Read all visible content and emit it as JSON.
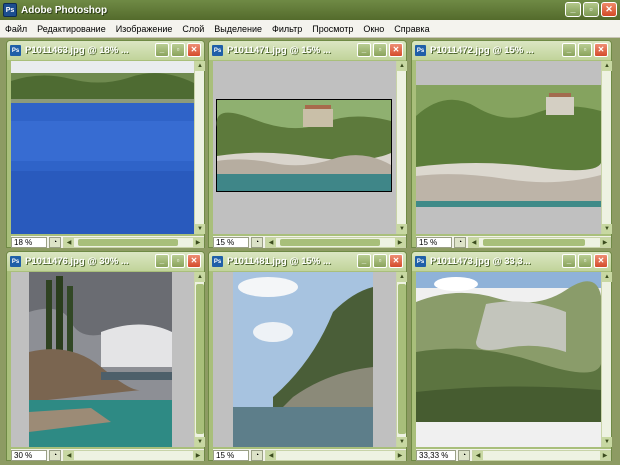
{
  "app": {
    "title": "Adobe Photoshop",
    "logo_text": "Ps"
  },
  "window_buttons": {
    "minimize": "_",
    "maximize": "▫",
    "close": "✕"
  },
  "menu": [
    "Файл",
    "Редактирование",
    "Изображение",
    "Слой",
    "Выделение",
    "Фильтр",
    "Просмотр",
    "Окно",
    "Справка"
  ],
  "documents": [
    {
      "title": "P1011463.jpg @ 18% ...",
      "zoom": "18 %"
    },
    {
      "title": "P1011471.jpg @ 15% ...",
      "zoom": "15 %"
    },
    {
      "title": "P1011472.jpg @ 15% ...",
      "zoom": "15 %"
    },
    {
      "title": "P1011476.jpg @ 30% ...",
      "zoom": "30 %"
    },
    {
      "title": "P1011481.jpg @ 15% ...",
      "zoom": "15 %"
    },
    {
      "title": "P1011473.jpg @ 33,3...",
      "zoom": "33,33 %"
    }
  ],
  "colors": {
    "accent": "#6f8a45",
    "workspace": "#8d9b63",
    "canvas_gray": "#c0c0c0"
  }
}
